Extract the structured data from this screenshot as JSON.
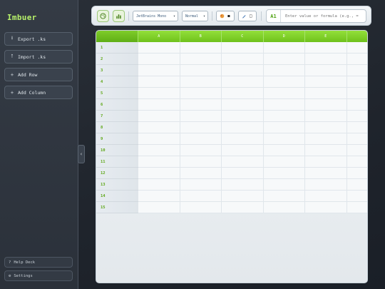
{
  "app": {
    "brand": "Imbuer"
  },
  "sidebar": {
    "actions": [
      {
        "icon": "upload-icon",
        "glyph": "⭳",
        "label": "Export .ks"
      },
      {
        "icon": "import-icon",
        "glyph": "⭡",
        "label": "Import .ks"
      },
      {
        "icon": "plus-icon",
        "glyph": "+",
        "label": "Add Row"
      },
      {
        "icon": "plus-icon",
        "glyph": "+",
        "label": "Add Column"
      }
    ],
    "footer": [
      {
        "icon": "help-icon",
        "glyph": "?",
        "label": "Help Deck"
      },
      {
        "icon": "gear-icon",
        "glyph": "⚙",
        "label": "Settings"
      }
    ],
    "collapse_glyph": "‹"
  },
  "toolbar": {
    "font_family": "JetBrains Mono",
    "font_weight": "Normal",
    "fill_icon": "palette-icon",
    "chart_icon": "chart-icon",
    "color_glyph": "◼",
    "border_glyph": "□"
  },
  "formula_bar": {
    "cell_ref": "A1",
    "placeholder": "Enter value or formula (e.g., ="
  },
  "grid": {
    "columns": [
      "A",
      "B",
      "C",
      "D",
      "E",
      ""
    ],
    "rows": [
      "1",
      "2",
      "3",
      "4",
      "5",
      "6",
      "7",
      "8",
      "9",
      "10",
      "11",
      "12",
      "13",
      "14",
      "15"
    ]
  },
  "colors": {
    "accent": "#6fc11c",
    "brand": "#b7f06a"
  }
}
